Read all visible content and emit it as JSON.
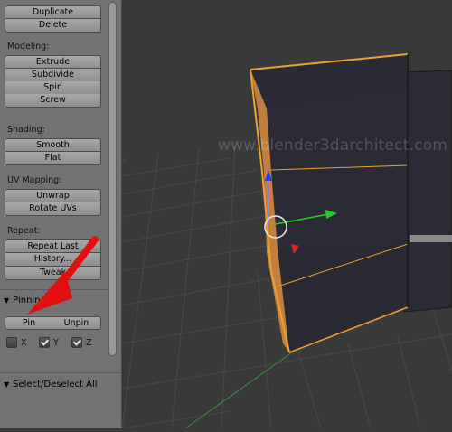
{
  "toolshelf": {
    "buttons": {
      "duplicate": "Duplicate",
      "delete": "Delete"
    },
    "modeling": {
      "label": "Modeling:",
      "extrude": "Extrude",
      "subdivide": "Subdivide",
      "spin": "Spin",
      "screw": "Screw"
    },
    "shading": {
      "label": "Shading:",
      "smooth": "Smooth",
      "flat": "Flat"
    },
    "uv_mapping": {
      "label": "UV Mapping:",
      "unwrap": "Unwrap",
      "rotate_uvs": "Rotate UVs"
    },
    "repeat": {
      "label": "Repeat:",
      "repeat_last": "Repeat Last",
      "history": "History...",
      "tweak": "Tweak"
    },
    "pinning": {
      "label": "Pinning",
      "pin": "Pin",
      "unpin": "Unpin",
      "x_label": "X",
      "y_label": "Y",
      "z_label": "Z",
      "x_checked": false,
      "y_checked": true,
      "z_checked": true
    },
    "select_deselect": {
      "label": "Select/Deselect All"
    }
  },
  "viewport": {
    "watermark": "www.blender3darchitect.com"
  },
  "colors": {
    "panel_bg": "#727272",
    "viewport_bg": "#3a3a3a",
    "grid": "#4a4a4a",
    "mesh_face": "#2a2a34",
    "selected_edge": "#f0a030",
    "annotation_arrow": "#e01010",
    "gizmo_x": "#e02020",
    "gizmo_y": "#20d020",
    "gizmo_z": "#2040f0"
  }
}
